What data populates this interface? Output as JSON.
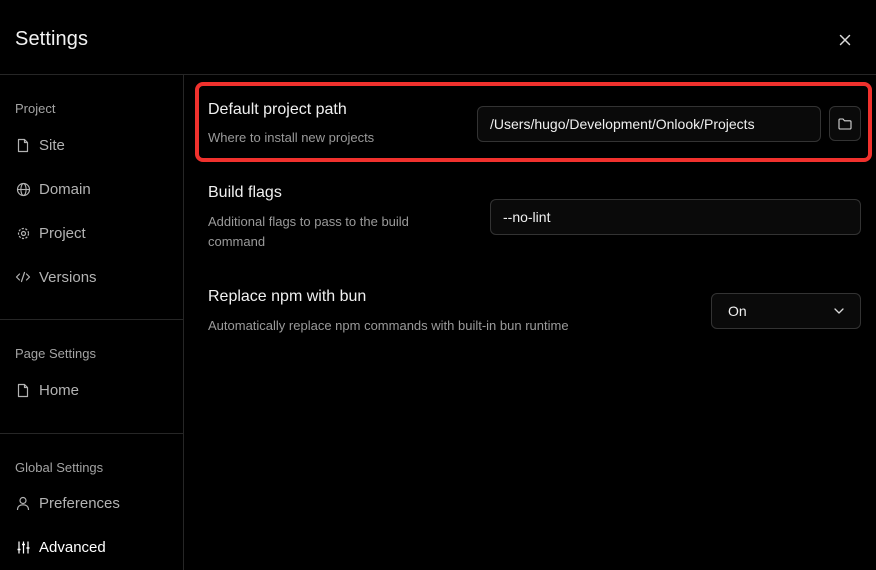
{
  "header": {
    "title": "Settings",
    "close_icon": "close-icon"
  },
  "sidebar": {
    "project": {
      "title": "Project",
      "items": [
        {
          "label": "Site",
          "icon": "file-icon"
        },
        {
          "label": "Domain",
          "icon": "globe-icon"
        },
        {
          "label": "Project",
          "icon": "gear-icon"
        },
        {
          "label": "Versions",
          "icon": "code-icon"
        }
      ]
    },
    "page_settings": {
      "title": "Page Settings",
      "items": [
        {
          "label": "Home",
          "icon": "file-icon"
        }
      ]
    },
    "global_settings": {
      "title": "Global Settings",
      "items": [
        {
          "label": "Preferences",
          "icon": "user-icon"
        },
        {
          "label": "Advanced",
          "icon": "sliders-icon",
          "active": true
        }
      ]
    }
  },
  "main": {
    "default_path": {
      "title": "Default project path",
      "description": "Where to install new projects",
      "value": "/Users/hugo/Development/Onlook/Projects"
    },
    "build_flags": {
      "title": "Build flags",
      "description_line1": "Additional flags to pass to the build",
      "description_line2": "command",
      "value": "--no-lint"
    },
    "replace_npm": {
      "title": "Replace npm with bun",
      "description": "Automatically replace npm commands with built-in bun runtime",
      "value": "On"
    }
  },
  "colors": {
    "highlight": "#f0312d",
    "background": "#000000",
    "border": "#262626"
  }
}
